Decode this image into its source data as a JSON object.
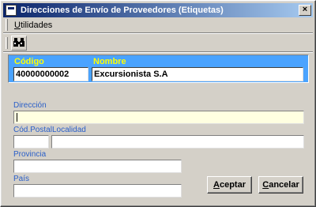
{
  "window": {
    "title": "Direcciones de Envío de Proveedores (Etiquetas)",
    "close_glyph": "×"
  },
  "menu": {
    "utilidades": {
      "hotkey": "U",
      "rest": "tilidades"
    }
  },
  "toolbar": {
    "search_icon": "binoculars-icon"
  },
  "header": {
    "codigo_label": "Código",
    "codigo_value": "40000000002",
    "nombre_label": "Nombre",
    "nombre_value": "Excursionista S.A"
  },
  "form": {
    "direccion_label": "Dirección",
    "direccion_value": "",
    "cod_postal_label": "Cód.Postal",
    "cod_postal_value": "",
    "localidad_label": "Localidad",
    "localidad_value": "",
    "provincia_label": "Provincia",
    "provincia_value": "",
    "pais_label": "País",
    "pais_value": ""
  },
  "buttons": {
    "aceptar": {
      "hotkey": "A",
      "rest": "ceptar"
    },
    "cancelar": {
      "hotkey": "C",
      "rest": "ancelar"
    }
  },
  "colors": {
    "panel": "#4aa3ff",
    "label_yellow": "#ffff00",
    "field_label_blue": "#2a5fc8",
    "active_field": "#ffffe1"
  }
}
